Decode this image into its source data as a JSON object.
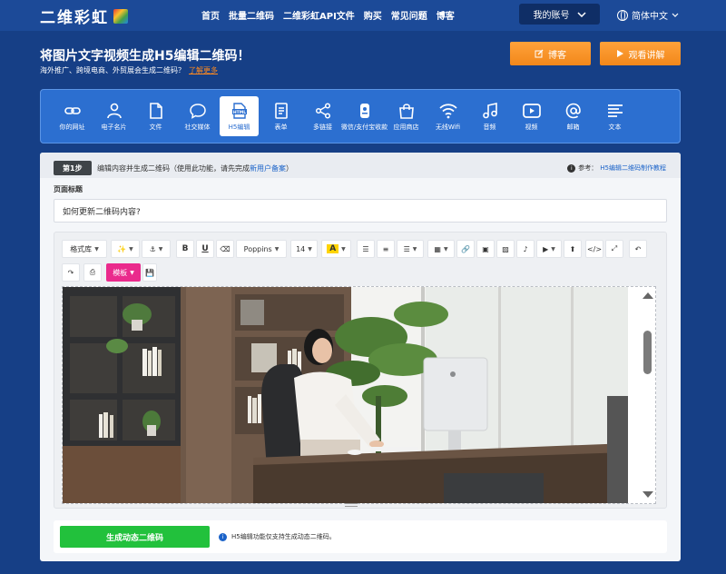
{
  "header": {
    "logo": "二维彩虹",
    "nav": [
      "首页",
      "批量二维码",
      "二维彩虹API文件",
      "购买",
      "常见问题",
      "博客"
    ],
    "account": "我的账号",
    "language": "简体中文"
  },
  "hero": {
    "title": "将图片文字视频生成H5编辑二维码！",
    "subtitle": "海外推广、跨境电商、外贸展会生成二维码？",
    "subtitle_link": "了解更多",
    "blog_button": "博客",
    "tutorial_button": "观看讲解"
  },
  "types": [
    {
      "label": "你的网址",
      "icon": "link-icon"
    },
    {
      "label": "电子名片",
      "icon": "person-icon"
    },
    {
      "label": "文件",
      "icon": "file-icon"
    },
    {
      "label": "社交媒体",
      "icon": "chat-icon"
    },
    {
      "label": "H5编辑",
      "icon": "html-icon",
      "active": true
    },
    {
      "label": "表单",
      "icon": "form-icon"
    },
    {
      "label": "多链接",
      "icon": "share-icon"
    },
    {
      "label": "微信/支付宝收款",
      "icon": "wallet-icon"
    },
    {
      "label": "应用商店",
      "icon": "store-icon"
    },
    {
      "label": "无线Wifi",
      "icon": "wifi-icon"
    },
    {
      "label": "音频",
      "icon": "music-icon"
    },
    {
      "label": "视频",
      "icon": "video-icon"
    },
    {
      "label": "邮箱",
      "icon": "at-icon"
    },
    {
      "label": "文本",
      "icon": "text-icon"
    }
  ],
  "step": {
    "badge": "第1步",
    "text": "编辑内容并生成二维码（使用此功能，请先完成",
    "link": "新用户备案",
    "text_end": "）",
    "help_label": "参考：",
    "help_link": "H5编辑二维码制作教程"
  },
  "page_title": {
    "label": "页面标题",
    "value": "如何更新二维码内容?"
  },
  "editor": {
    "format_library": "格式库",
    "font": "Poppins",
    "font_size": "14",
    "template": "模板"
  },
  "bottom": {
    "generate": "生成动态二维码",
    "note": "H5编辑功能仅支持生成动态二维码。"
  }
}
